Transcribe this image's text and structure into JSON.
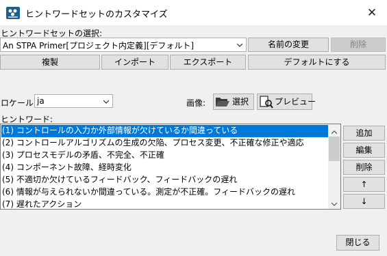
{
  "window": {
    "title": "ヒントワードセットのカスタマイズ",
    "close_glyph": "✕"
  },
  "hint_set": {
    "label": "ヒントワードセットの選択:",
    "selected": "An STPA Primer[プロジェクト内定義][デフォルト]",
    "rename_label": "名前の変更",
    "delete_label": "削除"
  },
  "actions": {
    "duplicate": "複製",
    "import": "インポート",
    "export": "エクスポート",
    "set_default": "デフォルトにする"
  },
  "locale": {
    "label": "ロケール:",
    "value": "ja"
  },
  "image": {
    "label": "画像:",
    "select_label": "選択",
    "preview_label": "プレビュー"
  },
  "hint_words": {
    "label": "ヒントワード:",
    "selected_index": 0,
    "items": [
      "(1) コントロールの入力か外部情報が欠けているか間違っている",
      "(2) コントロールアルゴリズムの生成の欠陥、プロセス変更、不正確な修正や適応",
      "(3) プロセスモデルの矛盾、不完全、不正確",
      "(4) コンポーネント故障、経時変化",
      "(5) 不適切か欠けているフィードバック、フィードバックの遅れ",
      "(6) 情報が与えられないか間違っている。測定が不正確。フィードバックの遅れ",
      "(7) 遅れたアクション"
    ]
  },
  "side_buttons": {
    "add": "追加",
    "edit": "編集",
    "delete": "削除",
    "up": "↑",
    "down": "↓"
  },
  "footer": {
    "close_label": "閉じる"
  },
  "colors": {
    "selection": "#0078d7",
    "button_face": "#e1e1e1",
    "window_bg": "#f0f0f0"
  },
  "icons": {
    "app": "app-logo-icon",
    "close": "close-icon",
    "dropdown": "chevron-down-icon",
    "folder": "folder-open-icon",
    "preview": "preview-icon",
    "scroll_up": "chevron-up-icon",
    "scroll_down": "chevron-down-icon"
  }
}
